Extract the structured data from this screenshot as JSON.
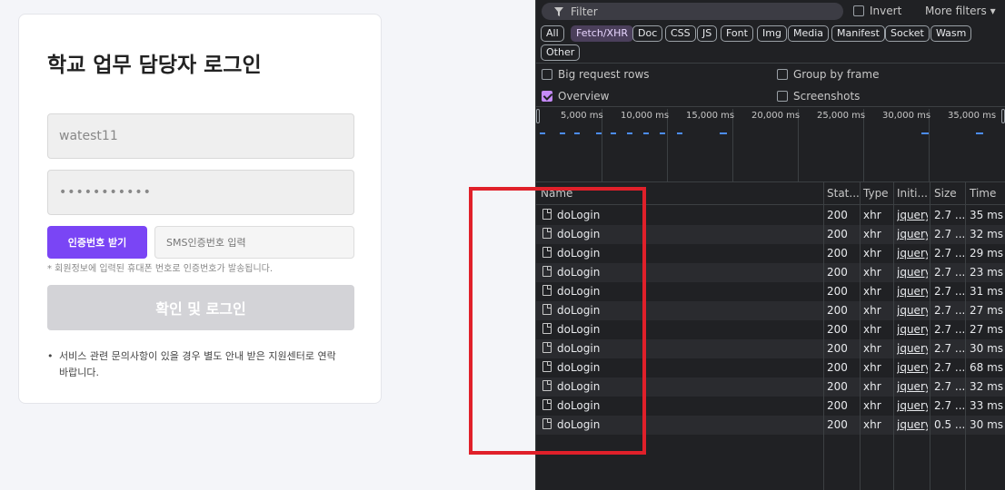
{
  "login": {
    "title": "학교 업무 담당자 로그인",
    "id_value": "watest11",
    "pw_value": "•••••••••••",
    "cert_button": "인증번호 받기",
    "sms_placeholder": "SMS인증번호 입력",
    "notice": "* 회원정보에 입력된 휴대폰 번호로 인증번호가 발송됩니다.",
    "login_button": "확인 및 로그인",
    "help_text": "서비스 관련 문의사항이 있을 경우 별도 안내 받은 지원센터로 연락 바랍니다."
  },
  "devtools": {
    "filter_placeholder": "Filter",
    "filter_icon": "filter-funnel-icon",
    "invert_label": "Invert",
    "more_filters_label": "More filters",
    "type_chips": [
      "All",
      "Fetch/XHR",
      "Doc",
      "CSS",
      "JS",
      "Font",
      "Img",
      "Media",
      "Manifest",
      "Socket",
      "Wasm",
      "Other"
    ],
    "active_chip": "Fetch/XHR",
    "options": {
      "big_request_rows": "Big request rows",
      "group_by_frame": "Group by frame",
      "overview": "Overview",
      "screenshots": "Screenshots"
    },
    "overview_checked": true,
    "timeline_labels": [
      "5,000 ms",
      "10,000 ms",
      "15,000 ms",
      "20,000 ms",
      "25,000 ms",
      "30,000 ms",
      "35,000 ms"
    ],
    "columns": [
      "Name",
      "Stat...",
      "Type",
      "Initi...",
      "Size",
      "Time"
    ],
    "rows": [
      {
        "name": "doLogin",
        "status": "200",
        "type": "xhr",
        "initiator": "jquery.",
        "size": "2.7 ...",
        "time": "35 ms"
      },
      {
        "name": "doLogin",
        "status": "200",
        "type": "xhr",
        "initiator": "jquery.",
        "size": "2.7 ...",
        "time": "32 ms"
      },
      {
        "name": "doLogin",
        "status": "200",
        "type": "xhr",
        "initiator": "jquery.",
        "size": "2.7 ...",
        "time": "29 ms"
      },
      {
        "name": "doLogin",
        "status": "200",
        "type": "xhr",
        "initiator": "jquery.",
        "size": "2.7 ...",
        "time": "23 ms"
      },
      {
        "name": "doLogin",
        "status": "200",
        "type": "xhr",
        "initiator": "jquery.",
        "size": "2.7 ...",
        "time": "31 ms"
      },
      {
        "name": "doLogin",
        "status": "200",
        "type": "xhr",
        "initiator": "jquery.",
        "size": "2.7 ...",
        "time": "27 ms"
      },
      {
        "name": "doLogin",
        "status": "200",
        "type": "xhr",
        "initiator": "jquery.",
        "size": "2.7 ...",
        "time": "27 ms"
      },
      {
        "name": "doLogin",
        "status": "200",
        "type": "xhr",
        "initiator": "jquery.",
        "size": "2.7 ...",
        "time": "30 ms"
      },
      {
        "name": "doLogin",
        "status": "200",
        "type": "xhr",
        "initiator": "jquery.",
        "size": "2.7 ...",
        "time": "68 ms"
      },
      {
        "name": "doLogin",
        "status": "200",
        "type": "xhr",
        "initiator": "jquery.",
        "size": "2.7 ...",
        "time": "32 ms"
      },
      {
        "name": "doLogin",
        "status": "200",
        "type": "xhr",
        "initiator": "jquery.",
        "size": "2.7 ...",
        "time": "33 ms"
      },
      {
        "name": "doLogin",
        "status": "200",
        "type": "xhr",
        "initiator": "jquery.",
        "size": "0.5 ...",
        "time": "30 ms"
      }
    ]
  },
  "colors": {
    "accent_purple": "#7a45f5",
    "highlight_red": "#e0202a",
    "devtools_bg": "#202124",
    "timeline_blue": "#4c8df6"
  }
}
